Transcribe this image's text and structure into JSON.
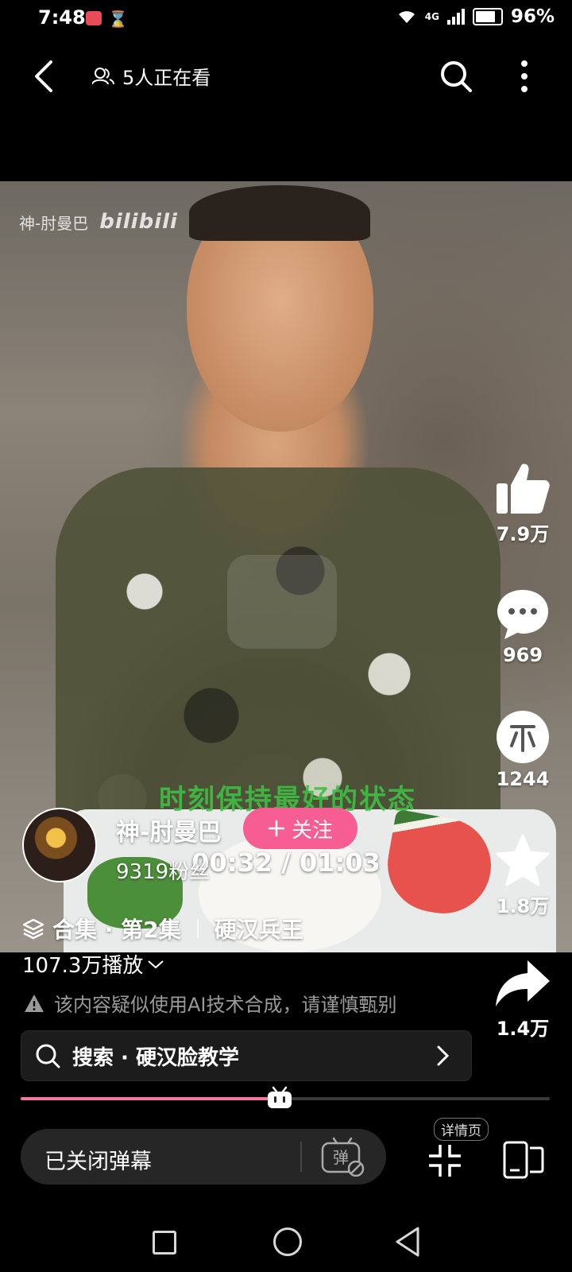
{
  "status_bar": {
    "time": "7:48",
    "signal_label": "4G",
    "battery": "96%"
  },
  "top_nav": {
    "viewers": "5人正在看"
  },
  "video": {
    "watermark_author": "神-肘曼巴",
    "watermark_logo": "bilibili",
    "subtitle": "时刻保持最好的状态",
    "time_readout": "00:32 / 01:03",
    "progress": 0.49
  },
  "rail": {
    "likes": "7.9万",
    "comments": "969",
    "coins": "1244",
    "favorites": "1.8万",
    "shares": "1.4万"
  },
  "author": {
    "name": "神-肘曼巴",
    "follow_label": "关注",
    "fans": "9319粉丝"
  },
  "collection": {
    "label": "合集 · 第2集",
    "series": "硬汉兵王"
  },
  "plays": "107.3万播放",
  "ai_warning": "该内容疑似使用AI技术合成，请谨慎甄别",
  "search_suggestion": "搜索 · 硬汉脸教学",
  "bottom": {
    "danmaku_label": "已关闭弹幕",
    "danmaku_toggle_glyph": "弹",
    "detail_tag": "详情页"
  },
  "colors": {
    "accent_pink": "#f65d92",
    "progress_pink": "#f4779e",
    "subtitle_green": "#3fbf45"
  },
  "icons": [
    "back-icon",
    "viewers-icon",
    "search-icon",
    "more-icon",
    "like-icon",
    "comment-icon",
    "coin-icon",
    "favorite-icon",
    "share-icon",
    "collection-icon",
    "warning-icon",
    "chevron-right-icon",
    "fullscreen-exit-icon",
    "split-screen-icon"
  ]
}
